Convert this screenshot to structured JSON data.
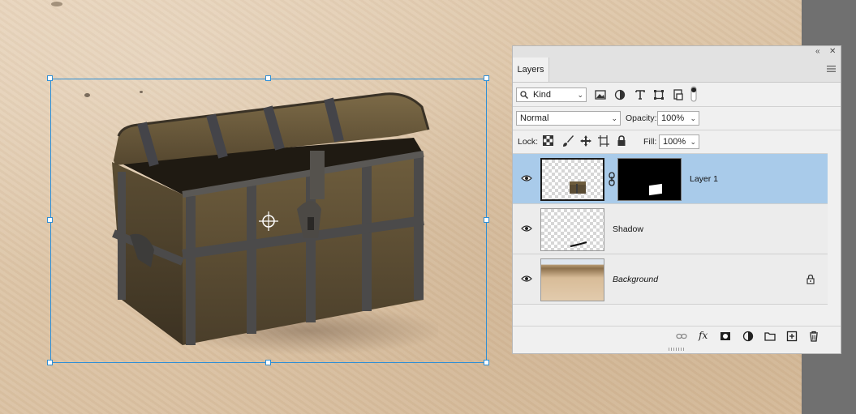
{
  "panel": {
    "tab": "Layers",
    "filter": {
      "label": "Kind"
    },
    "blend_mode": "Normal",
    "opacity_label": "Opacity:",
    "opacity_value": "100%",
    "lock_label": "Lock:",
    "fill_label": "Fill:",
    "fill_value": "100%",
    "layers": [
      {
        "name": "Layer 1",
        "selected": true,
        "visible": true,
        "has_mask": true
      },
      {
        "name": "Shadow",
        "selected": false,
        "visible": true
      },
      {
        "name": "Background",
        "selected": false,
        "visible": true,
        "locked": true,
        "italic": true
      }
    ]
  },
  "icons": {
    "topbar": [
      "collapse-icon",
      "close-icon"
    ],
    "filters": [
      "image-filter-icon",
      "adjustment-filter-icon",
      "type-filter-icon",
      "shape-filter-icon",
      "smartobject-filter-icon",
      "filter-toggle-icon"
    ],
    "locks": [
      "lock-transparent-icon",
      "lock-paint-icon",
      "lock-move-icon",
      "lock-artboard-icon",
      "lock-all-icon"
    ],
    "bottom": [
      "link-icon",
      "fx-icon",
      "mask-icon",
      "adjustment-icon",
      "group-icon",
      "new-layer-icon",
      "delete-icon"
    ]
  },
  "colors": {
    "selection": "#a9cbea",
    "transform_box": "#2e8fd6",
    "panel_bg": "#f0f0f0"
  }
}
